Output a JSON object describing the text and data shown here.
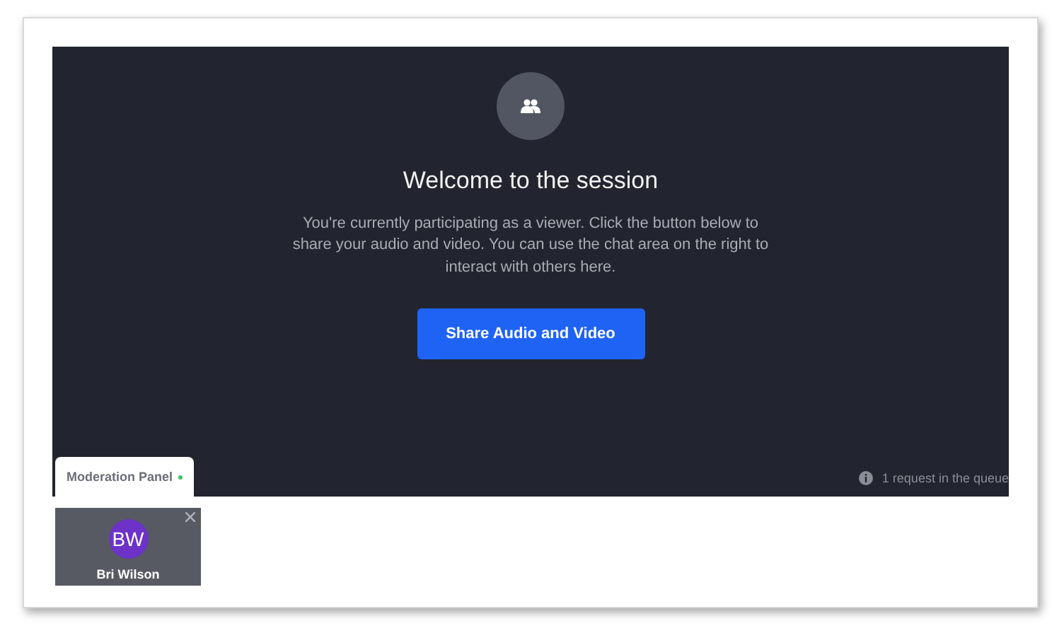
{
  "session": {
    "title": "Welcome to the session",
    "message": "You're currently participating as a viewer. Click the button below to share your audio and video. You can use the chat area on the right to interact with others here.",
    "button": "Share Audio and Video",
    "queue_status": "1 request in the queue"
  },
  "tabs": [
    {
      "label": "Moderation Panel",
      "selected": true,
      "indicator": true
    }
  ],
  "participants": [
    {
      "initials": "BW",
      "name": "Bri Wilson",
      "color": "#6d32c8",
      "dismissible": true
    }
  ]
}
